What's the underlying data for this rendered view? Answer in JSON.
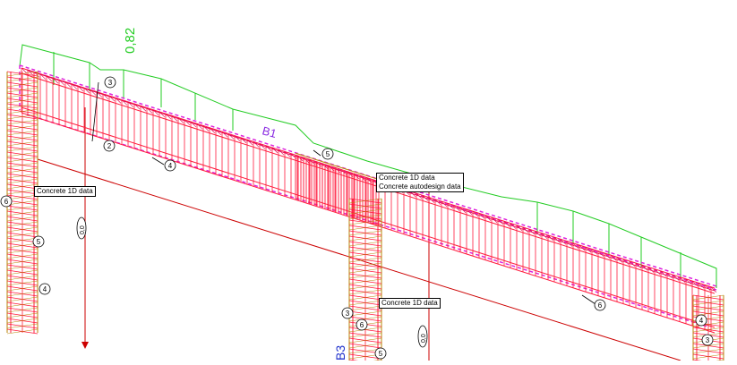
{
  "viewport": {
    "background": "#ffffff",
    "colors": {
      "envelope": "#22cc22",
      "rebar": "#ff1a3c",
      "rebar_dark": "#e0004a",
      "dashed_outline": "#dd22dd",
      "gridline": "#cc0000",
      "beam_label": "#8a2be2",
      "column_label": "#2233cc",
      "column_cage": "#b8860b"
    }
  },
  "moment_envelope": {
    "value_label": "0,82"
  },
  "members": {
    "beam_label": "B1",
    "column_label": "B3"
  },
  "bar_marks": [
    "3",
    "2",
    "4",
    "5",
    "6",
    "6",
    "5",
    "4",
    "3",
    "6",
    "5",
    "4",
    "3"
  ],
  "vertical_marks": [
    "0,0",
    "0,0"
  ],
  "tags": {
    "left_column": {
      "line1": "Concrete 1D data"
    },
    "beam_mid": {
      "line1": "Concrete 1D data",
      "line2": "Concrete autodesign data"
    },
    "middle_column": {
      "line1": "Concrete 1D data"
    }
  }
}
